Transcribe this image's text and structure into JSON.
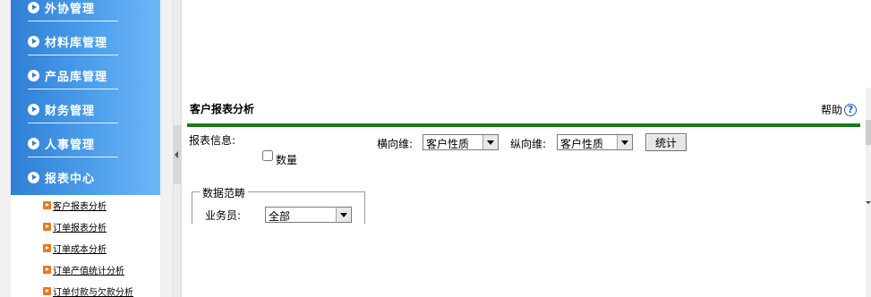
{
  "nav": {
    "items": [
      {
        "label": "外协管理"
      },
      {
        "label": "材料库管理"
      },
      {
        "label": "产品库管理"
      },
      {
        "label": "财务管理"
      },
      {
        "label": "人事管理"
      },
      {
        "label": "报表中心"
      }
    ],
    "subitems": [
      {
        "label": "客户报表分析"
      },
      {
        "label": "订单报表分析"
      },
      {
        "label": "订单成本分析"
      },
      {
        "label": "订单产值统计分析"
      },
      {
        "label": "订单付款与欠款分析"
      }
    ]
  },
  "page": {
    "title": "客户报表分析",
    "help_label": "帮助",
    "help_icon": "?"
  },
  "form": {
    "report_info_label": "报表信息:",
    "quantity_label": "数量",
    "horizontal_label": "横向维:",
    "horizontal_value": "客户性质",
    "vertical_label": "纵向维:",
    "vertical_value": "客户性质",
    "stat_button": "统计",
    "range_legend": "数据范畴",
    "salesman_label": "业务员:",
    "salesman_value": "全部"
  },
  "colors": {
    "nav_blue": "#3a8be0",
    "rule_green": "#1a7a1a",
    "sub_arrow_orange": "#e87a1b",
    "help_blue": "#1b5cc2"
  }
}
